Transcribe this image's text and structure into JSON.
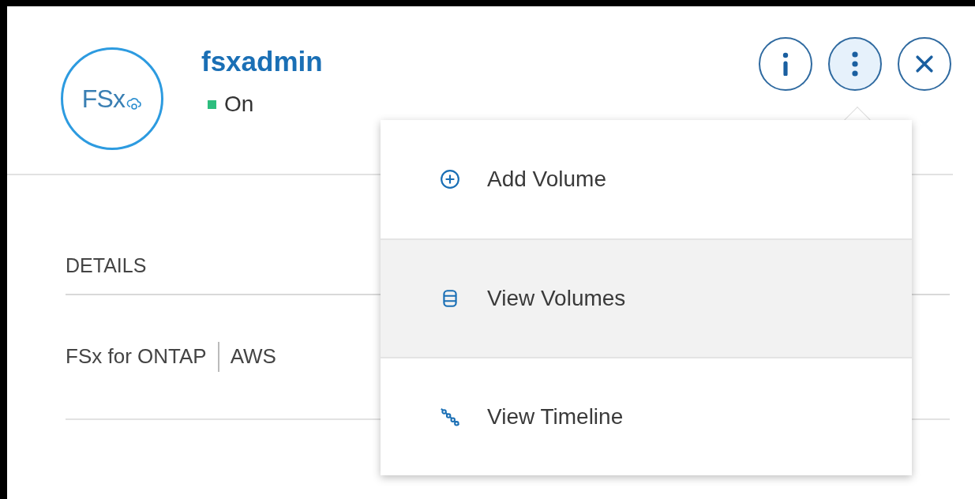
{
  "header": {
    "logo_text": "FSx",
    "title": "fsxadmin",
    "status": {
      "label": "On",
      "color": "#2dbd7e"
    }
  },
  "actions": [
    {
      "kind": "info",
      "selected": false
    },
    {
      "kind": "more",
      "selected": true
    },
    {
      "kind": "close",
      "selected": false
    }
  ],
  "details": {
    "heading": "DETAILS",
    "tags": [
      "FSx for ONTAP",
      "AWS"
    ]
  },
  "menu": {
    "items": [
      {
        "kind": "add",
        "label": "Add Volume",
        "selected": false
      },
      {
        "kind": "volumes",
        "label": "View Volumes",
        "selected": true
      },
      {
        "kind": "timeline",
        "label": "View Timeline",
        "selected": false
      }
    ]
  }
}
